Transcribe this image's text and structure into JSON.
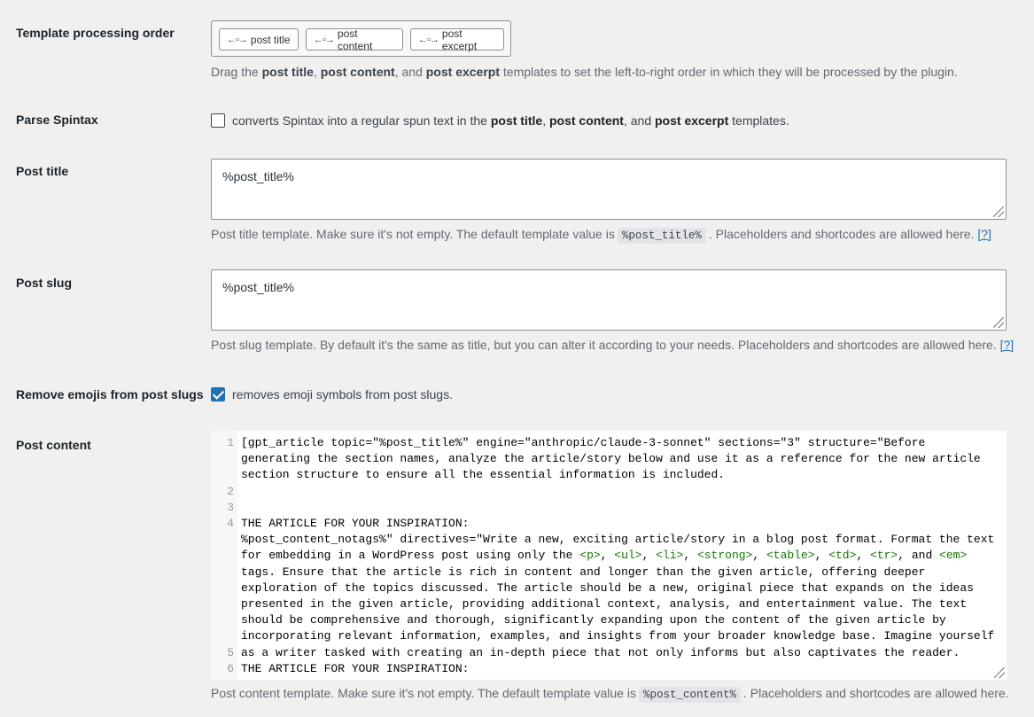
{
  "processing_order": {
    "label": "Template processing order",
    "items": [
      "post title",
      "post content",
      "post excerpt"
    ],
    "desc_pre": "Drag the ",
    "desc_b1": "post title",
    "desc_s1": ", ",
    "desc_b2": "post content",
    "desc_s2": ", and ",
    "desc_b3": "post excerpt",
    "desc_post": " templates to set the left-to-right order in which they will be processed by the plugin."
  },
  "parse_spintax": {
    "label": "Parse Spintax",
    "checked": false,
    "text_pre": "converts Spintax into a regular spun text in the ",
    "b1": "post title",
    "s1": ", ",
    "b2": "post content",
    "s2": ", and ",
    "b3": "post excerpt",
    "text_post": " templates."
  },
  "post_title": {
    "label": "Post title",
    "value": "%post_title%",
    "desc_pre": "Post title template. Make sure it's not empty. The default template value is",
    "default_value": "%post_title%",
    "desc_post": ". Placeholders and shortcodes are allowed here.",
    "help": "[?]"
  },
  "post_slug": {
    "label": "Post slug",
    "value": "%post_title%",
    "desc": "Post slug template. By default it's the same as title, but you can alter it according to your needs. Placeholders and shortcodes are allowed here.",
    "help": "[?]"
  },
  "remove_emojis": {
    "label": "Remove emojis from post slugs",
    "checked": true,
    "text": "removes emoji symbols from post slugs."
  },
  "post_content": {
    "label": "Post content",
    "line_numbers": [
      "1",
      "2",
      "3",
      "4",
      "5",
      "6"
    ],
    "line1": "[gpt_article topic=\"%post_title%\" engine=\"anthropic/claude-3-sonnet\" sections=\"3\" structure=\"Before generating the section names, analyze the article/story below and use it as a reference for the new article section structure to ensure all the essential information is included.",
    "line2": "",
    "line3": "THE ARTICLE FOR YOUR INSPIRATION:",
    "line4_pre": "%post_content_notags%\" directives=\"Write a new, exciting article/story in a blog post format. Format the text for embedding in a WordPress post using only the ",
    "tags": [
      "<p>",
      "<ul>",
      "<li>",
      "<strong>",
      "<table>",
      "<td>",
      "<tr>",
      "<em>"
    ],
    "line4_post": " tags. Ensure that the article is rich in content and longer than the given article, offering deeper exploration of the topics discussed. The article should be a new, original piece that expands on the ideas presented in the given article, providing additional context, analysis, and entertainment value. The text should be comprehensive and thorough, significantly expanding upon the content of the given article by incorporating relevant information, examples, and insights from your broader knowledge base. Imagine yourself as a writer tasked with creating an in-depth piece that not only informs but also captivates the reader.",
    "line5": "",
    "line6": "THE ARTICLE FOR YOUR INSPIRATION:",
    "desc_pre": "Post content template. Make sure it's not empty. The default template value is",
    "default_value": "%post_content%",
    "desc_post": ". Placeholders and shortcodes are allowed here."
  },
  "colors": {
    "accent": "#2271b1",
    "background": "#f0f0f1",
    "html_tag": "#117700"
  }
}
